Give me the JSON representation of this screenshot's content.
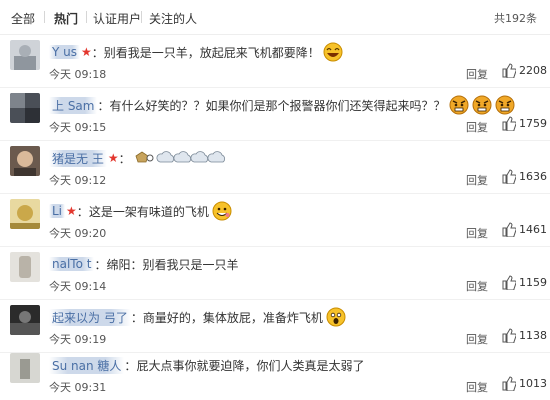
{
  "tabs": [
    {
      "label": "全部"
    },
    {
      "label": "热门"
    },
    {
      "label": "认证用户"
    },
    {
      "label": "关注的人"
    }
  ],
  "total": "共192条",
  "reply_label": "回复",
  "colors": {
    "username": "#4a6fa5",
    "star": "#e3372e",
    "text": "#333333"
  },
  "comments": [
    {
      "user": "Y    us",
      "text": "别看我是一只羊，放起屁来飞机都要降！",
      "time": "今天 09:18",
      "likes": "2208",
      "emoji": "laugh-emoji"
    },
    {
      "user": "上       Sam",
      "text": "有什么好笑的？？如果你们是那个报警器你们还笑得起来吗？？",
      "time": "今天 09:15",
      "likes": "1759",
      "emoji": "angry-emoji"
    },
    {
      "user": "猪是无     王",
      "text": "",
      "time": "今天 09:12",
      "likes": "1636",
      "emoji": "sheep-cloud-emoji"
    },
    {
      "user": "Li",
      "text": "这是一架有味道的飞机",
      "time": "今天 09:20",
      "likes": "1461",
      "emoji": "grin-emoji"
    },
    {
      "user": "   nalTo    t",
      "text": "绵阳：别看我只是一只羊",
      "time": "今天 09:14",
      "likes": "1159",
      "emoji": ""
    },
    {
      "user": "起来以为      弓了",
      "text": "商量好的，集体放屁，准备炸飞机",
      "time": "今天 09:19",
      "likes": "1138",
      "emoji": "shock-emoji"
    },
    {
      "user": "Su      nan   糖人",
      "text": "屁大点事你就要迫降，你们人类真是太弱了",
      "time": "今天 09:31",
      "likes": "1013",
      "emoji": ""
    }
  ]
}
